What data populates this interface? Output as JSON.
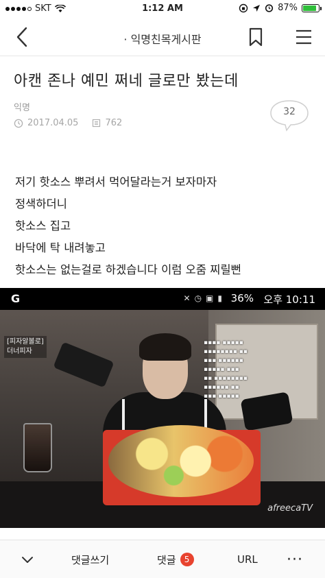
{
  "status_bar": {
    "carrier": "SKT",
    "time": "1:12 AM",
    "battery": "87%",
    "battery_level": 0.87
  },
  "nav": {
    "title": "· 익명친목게시판",
    "back_icon": "chevron-left-icon",
    "bookmark_icon": "bookmark-icon",
    "menu_icon": "hamburger-menu-icon"
  },
  "post": {
    "title": "아캔 존나 예민 쩌네 글로만 봤는데",
    "author": "익명",
    "date": "2017.04.05",
    "views": "762",
    "comment_count": "32",
    "body": [
      "저기 핫소스 뿌려서 먹어달라는거 보자마자",
      "정색하더니",
      "핫소스 집고",
      "바닥에 탁 내려놓고",
      "핫소스는 없는걸로 하겠습니다 이럼 오줌 찌릴뻔"
    ]
  },
  "embedded_image": {
    "status_logo": "G",
    "battery": "36%",
    "clock": "오후 10:11",
    "overlay_lines": [
      "[피자알볼로]",
      "더너피자"
    ],
    "watermark": "afreecaTV"
  },
  "toolbar": {
    "collapse_icon": "chevron-down-icon",
    "write_comment": "댓글쓰기",
    "comments_label": "댓글",
    "comments_badge": "5",
    "url_label": "URL",
    "more_icon": "more-dots-icon",
    "badge_color": "#e8432f"
  }
}
